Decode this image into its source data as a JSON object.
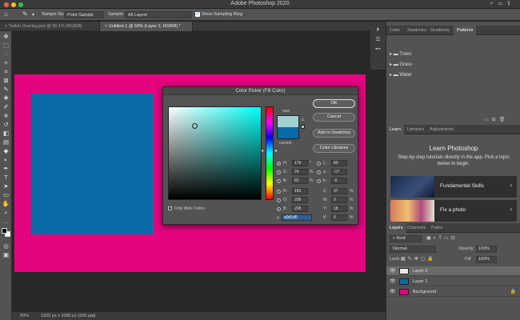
{
  "window": {
    "title": "Adobe Photoshop 2020"
  },
  "options_bar": {
    "sample_size_label": "Sample Size:",
    "sample_size_value": "Point Sample",
    "sample_label": "Sample:",
    "sample_value": "All Layers",
    "show_ring_label": "Show Sampling Ring"
  },
  "tabs": [
    {
      "label": "Twitch Overlay.psd @ 50.1% (RGB/8)"
    },
    {
      "label": "Untitled-1 @ 50% (Layer 2, RGB/8) *"
    }
  ],
  "canvas": {
    "doc_color": "#e4047f",
    "rect_color": "#0a6aa8"
  },
  "color_picker": {
    "title": "Color Picker (Fill Color)",
    "new_label": "new",
    "current_label": "current",
    "new_color": "#a0d1d0",
    "current_color": "#0a6aa8",
    "buttons": {
      "ok": "OK",
      "cancel": "Cancel",
      "add_swatches": "Add to Swatches",
      "color_libraries": "Color Libraries"
    },
    "hsb": {
      "h_label": "H:",
      "h": "179",
      "h_unit": "°",
      "s_label": "S:",
      "s": "24",
      "s_unit": "%",
      "b_label": "B:",
      "b": "82",
      "b_unit": "%"
    },
    "rgb": {
      "r_label": "R:",
      "r": "160",
      "g_label": "G:",
      "g": "209",
      "b_label": "B:",
      "b": "208"
    },
    "lab": {
      "l_label": "L:",
      "l": "80",
      "a_label": "a:",
      "a": "-17",
      "b_label": "b:",
      "b": "-5"
    },
    "cmyk": {
      "c_label": "C:",
      "c": "37",
      "m_label": "M:",
      "m": "9",
      "y_label": "Y:",
      "y": "18",
      "k_label": "K:",
      "k": "0",
      "unit": "%"
    },
    "hex_label": "#",
    "hex": "a0d1d0",
    "web_only_label": "Only Web Colors"
  },
  "patterns_panel": {
    "tabs": [
      "Color",
      "Swatches",
      "Gradients",
      "Patterns"
    ],
    "folders": [
      "Trees",
      "Grass",
      "Water"
    ]
  },
  "learn_panel": {
    "tabs": [
      "Learn",
      "Libraries",
      "Adjustments"
    ],
    "heading": "Learn Photoshop",
    "description": "Step-by-step tutorials directly in the app. Pick a topic below to begin.",
    "topics": [
      "Fundamental Skills",
      "Fix a photo"
    ]
  },
  "layers_panel": {
    "tabs": [
      "Layers",
      "Channels",
      "Paths"
    ],
    "kind_label": "Kind",
    "blend_mode": "Normal",
    "opacity_label": "Opacity:",
    "opacity": "100%",
    "lock_label": "Lock:",
    "fill_label": "Fill:",
    "fill": "100%",
    "layers": [
      {
        "name": "Layer 2",
        "color": "#e9e9e9"
      },
      {
        "name": "Layer 1",
        "color": "#0a6aa8"
      },
      {
        "name": "Background",
        "color": "#e4047f"
      }
    ]
  },
  "status_bar": {
    "zoom": "50%",
    "doc_info": "1920 px x 1080 px (300 ppi)"
  }
}
